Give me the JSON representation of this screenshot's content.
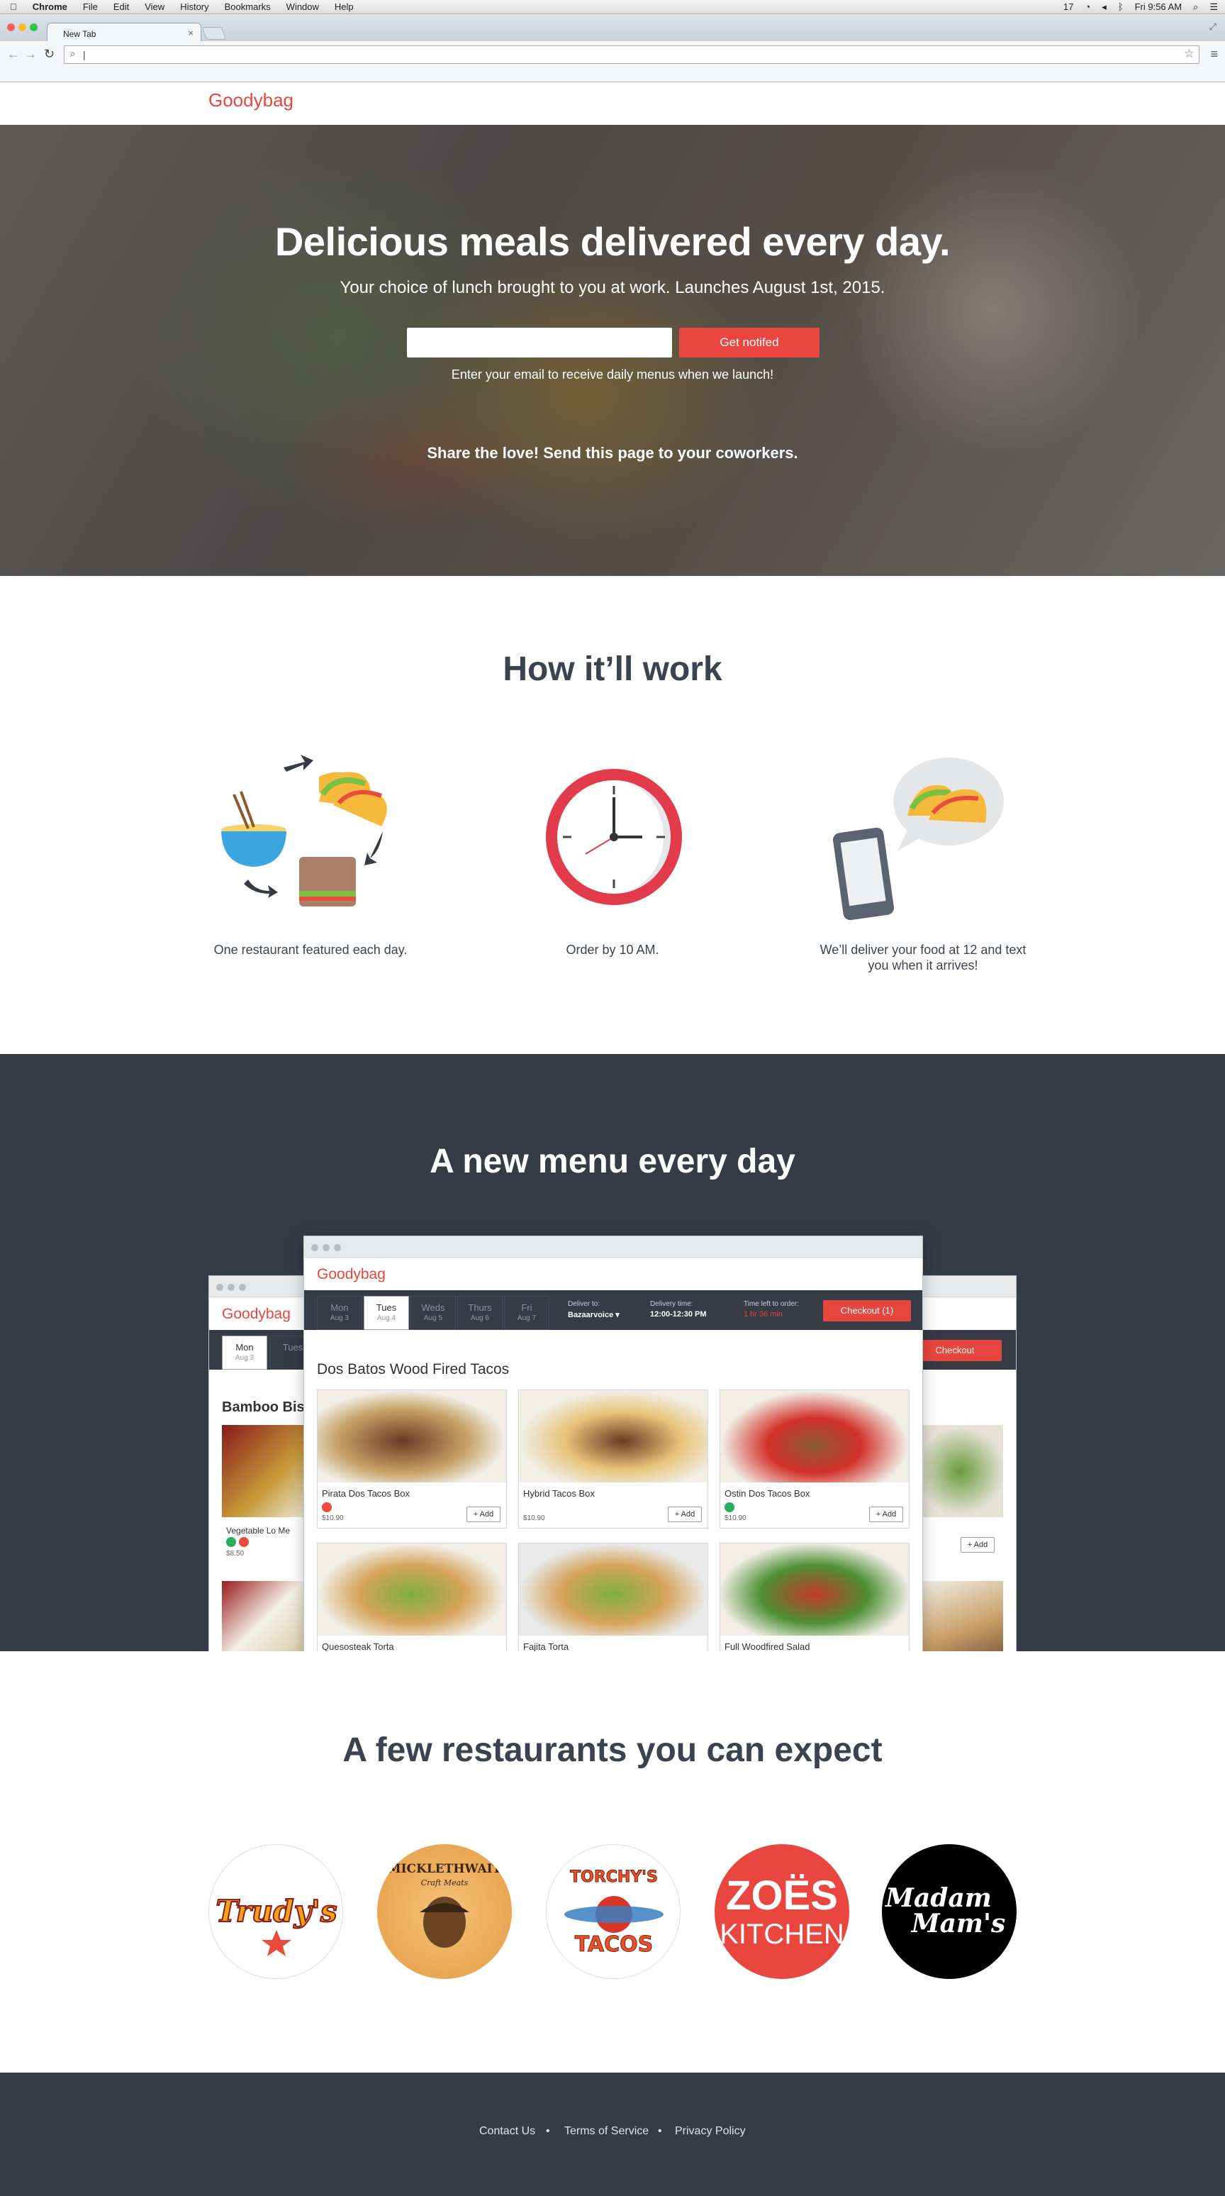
{
  "menubar": {
    "app": "Chrome",
    "items": [
      "File",
      "Edit",
      "View",
      "History",
      "Bookmarks",
      "Window",
      "Help"
    ],
    "status_number": "17",
    "clock": "Fri 9:56 AM"
  },
  "browser": {
    "tab_title": "New Tab",
    "tab_close": "×",
    "address_value": "|"
  },
  "site": {
    "logo": "Goodybag",
    "hero": {
      "title": "Delicious meals delivered every day.",
      "subtitle": "Your choice of lunch brought to you at work. Launches August 1st, 2015.",
      "email_placeholder": "",
      "cta": "Get notifed",
      "hint": "Enter your email to receive daily menus when we launch!",
      "share": "Share the love! Send this page to your coworkers."
    },
    "how": {
      "title": "How it’ll work",
      "steps": [
        {
          "text": "One restaurant featured each day.",
          "icon": "food-cycle-icon"
        },
        {
          "text": "Order by 10 AM.",
          "icon": "clock-icon"
        },
        {
          "text": "We’ll deliver your food at 12 and text you when it arrives!",
          "icon": "phone-taco-icon"
        }
      ]
    },
    "menu": {
      "title": "A new menu every day",
      "front": {
        "logo": "Goodybag",
        "days": [
          {
            "name": "Mon",
            "date": "Aug 3"
          },
          {
            "name": "Tues",
            "date": "Aug 4"
          },
          {
            "name": "Weds",
            "date": "Aug 5"
          },
          {
            "name": "Thurs",
            "date": "Aug 6"
          },
          {
            "name": "Fri",
            "date": "Aug 7"
          }
        ],
        "deliver_to_label": "Deliver to:",
        "deliver_to_value": "Bazaarvoice ▾",
        "delivery_time_label": "Delivery time:",
        "delivery_time_value": "12:00-12:30 PM",
        "time_left_label": "Time left to order:",
        "time_left_value": "1 hr 36 min",
        "checkout": "Checkout (1)",
        "restaurant": "Dos Batos Wood Fired Tacos",
        "items": [
          {
            "name": "Pirata Dos Tacos Box",
            "price": "$10.90",
            "add": "+ Add"
          },
          {
            "name": "Hybrid Tacos Box",
            "price": "$10.90",
            "add": "+ Add"
          },
          {
            "name": "Ostin Dos Tacos Box",
            "price": "$10.90",
            "add": "+ Add"
          },
          {
            "name": "Quesosteak Torta",
            "price": "",
            "add": ""
          },
          {
            "name": "Fajita Torta",
            "price": "",
            "add": ""
          },
          {
            "name": "Full Woodfired Salad",
            "price": "",
            "add": ""
          }
        ]
      },
      "back": {
        "logo": "Goodybag",
        "day1": "Mon",
        "day1_date": "Aug 3",
        "day2": "Tues",
        "restaurant": "Bamboo Bis",
        "item": "Vegetable Lo Me",
        "price": "$8.50",
        "checkout": "Checkout",
        "add": "+ Add"
      }
    },
    "restaurants": {
      "title": "A few restaurants you can expect",
      "logos": [
        "Trudy's",
        "MICKLETHWAIT Craft Meats",
        "TORCHY'S TACOS",
        "ZOËS KITCHEN",
        "Madam Mam's"
      ]
    },
    "footer": {
      "links": [
        "Contact Us",
        "Terms of Service",
        "Privacy Policy"
      ]
    }
  },
  "colors": {
    "brand": "#e9463f",
    "dark": "#363b46"
  }
}
